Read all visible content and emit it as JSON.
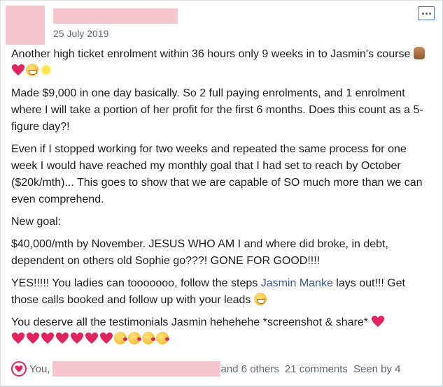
{
  "post": {
    "date": "25 July 2019",
    "paragraphs": {
      "p1": "Another high ticket enrolment within 36 hours only 9 weeks in to Jasmin's course",
      "p2": "Made $9,000 in one day basically. So 2 full paying enrolments, and 1 enrolment where I will take a portion of her profit for the first 6 months. Does this count as a 5-figure day?!",
      "p3": "Even if I stopped working for two weeks and repeated the same process for one week I would have reached my monthly goal that I had set to reach by October ($20k/mth)... This goes to show that we are capable of SO much more than we can even comprehend.",
      "p4": "New goal:",
      "p5": "$40,000/mth by November. JESUS WHO AM I and where did broke, in debt, dependent on others old Sophie go???! GONE FOR GOOD!!!!",
      "p6_before": "YES!!!!! You ladies can tooooooo, follow the steps ",
      "p6_link": "Jasmin Manke",
      "p6_after": " lays out!!! Get those calls booked and follow up with your leads",
      "p7": "You deserve all the testimonials Jasmin hehehehe *screenshot & share*"
    },
    "icons": {
      "p1_emojis": [
        "prayer-hands-icon",
        "heart-icon",
        "grin-icon",
        "sun-icon"
      ],
      "p6_emojis": [
        "grin-icon"
      ],
      "p7_emojis": [
        "heart-icon",
        "heart-icon",
        "heart-icon",
        "heart-icon",
        "heart-icon",
        "heart-icon",
        "heart-icon",
        "kiss-face-icon",
        "kiss-face-icon",
        "kiss-face-icon",
        "kiss-face-icon"
      ]
    }
  },
  "footer": {
    "you_label": "You,",
    "others_label": "and 6 others",
    "comments_label": "21 comments",
    "seen_label": "Seen by 4"
  },
  "colors": {
    "redaction": "#f5c6ce",
    "link": "#385898",
    "heart": "#e0245e",
    "meta_text": "#606770"
  }
}
